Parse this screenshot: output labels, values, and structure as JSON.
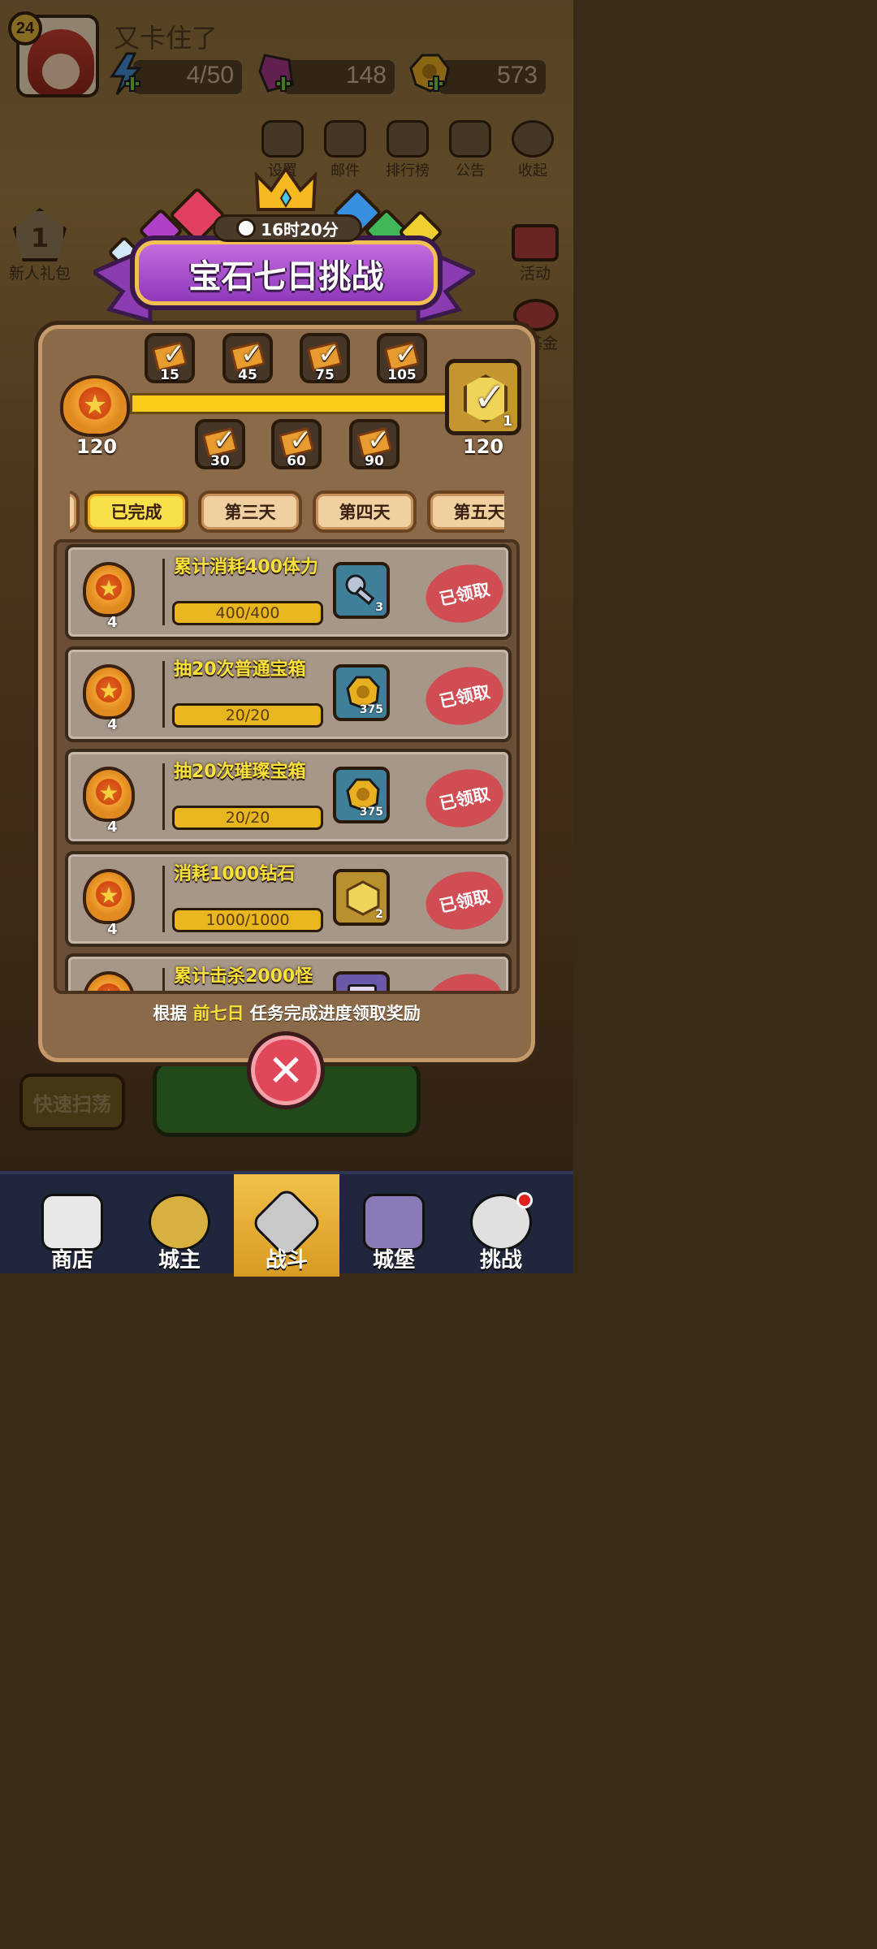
{
  "player": {
    "level": "24",
    "name": "又卡住了"
  },
  "resources": [
    {
      "icon": "energy-icon",
      "value": "4/50"
    },
    {
      "icon": "gem-icon",
      "value": "148"
    },
    {
      "icon": "coin-icon",
      "value": "573"
    }
  ],
  "top_buttons": [
    "设置",
    "邮件",
    "排行榜",
    "公告",
    "收起"
  ],
  "side_left": {
    "gift_number": "1",
    "gift_label": "新人礼包"
  },
  "side_right": {
    "activity": "活动",
    "fund": "基金"
  },
  "event": {
    "title": "宝石七日挑战",
    "timer": "16时20分",
    "start_points": "120",
    "progress_fraction": 1.0,
    "milestones_top": [
      "15",
      "45",
      "75",
      "105"
    ],
    "milestones_bottom": [
      "30",
      "60",
      "90"
    ],
    "grand_prize_count": "1",
    "grand_prize_points": "120"
  },
  "tabs": [
    "已完成",
    "第三天",
    "第四天",
    "第五天"
  ],
  "tasks": [
    {
      "name": "累计消耗400体力",
      "progress": "400/400",
      "badge": "4",
      "reward_icon": "key-icon",
      "reward_count": "3",
      "reward_bg": "#3f7f9a",
      "status": "已领取"
    },
    {
      "name": "抽20次普通宝箱",
      "progress": "20/20",
      "badge": "4",
      "reward_icon": "coin-icon",
      "reward_count": "375",
      "reward_bg": "#3f7f9a",
      "status": "已领取"
    },
    {
      "name": "抽20次璀璨宝箱",
      "progress": "20/20",
      "badge": "4",
      "reward_icon": "coin-icon",
      "reward_count": "375",
      "reward_bg": "#3f7f9a",
      "status": "已领取"
    },
    {
      "name": "消耗1000钻石",
      "progress": "1000/1000",
      "badge": "4",
      "reward_icon": "gold-gem-icon",
      "reward_count": "2",
      "reward_bg": "#b8902e",
      "status": "已领取"
    },
    {
      "name": "累计击杀2000怪",
      "progress": "",
      "badge": "",
      "reward_icon": "scroll-icon",
      "reward_count": "",
      "reward_bg": "#6a58a8",
      "status": ""
    }
  ],
  "footer": {
    "prefix": "根据 ",
    "highlight": "前七日",
    "suffix": " 任务完成进度领取奖励"
  },
  "quick_sweep": "快速扫荡",
  "nav": [
    "商店",
    "城主",
    "战斗",
    "城堡",
    "挑战"
  ],
  "colors": {
    "accent": "#f2c315",
    "banner": "#a04ed0",
    "close": "#e0485a",
    "stamp": "#d6404a"
  }
}
